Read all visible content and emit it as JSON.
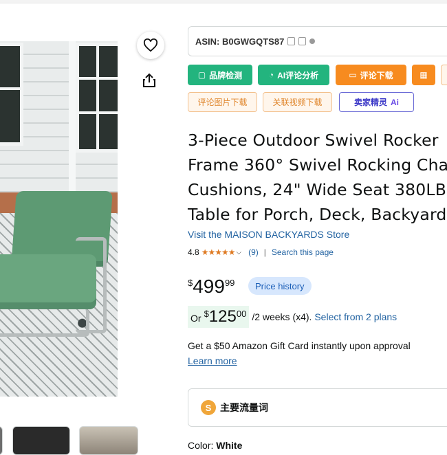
{
  "product": {
    "title_lines": [
      "3-Piece Outdoor Swivel Rocker",
      "Frame 360° Swivel Rocking Cha",
      "Cushions, 24\" Wide Seat 380LB",
      "Table for Porch, Deck, Backyard"
    ],
    "store_link": "Visit the MAISON BACKYARDS Store",
    "rating": "4.8",
    "rating_value": 4.8,
    "review_count": "(9)",
    "search_link": "Search this page",
    "price": {
      "symbol": "$",
      "whole": "499",
      "fraction": "99"
    },
    "price_history": "Price history",
    "installment": {
      "or": "Or",
      "symbol": "$",
      "whole": "125",
      "fraction": "00",
      "terms": "/2 weeks (x4).",
      "plans_link": "Select from 2 plans"
    },
    "gift_card": "Get a $50 Amazon Gift Card instantly upon approval",
    "learn_more": "Learn more",
    "color_label": "Color:",
    "color_value": "White"
  },
  "plugin": {
    "asin": "ASIN: B0GWGQTS87",
    "buttons": {
      "brand_check": "品牌检测",
      "ai_review": "AI评论分析",
      "review_download": "评论下载",
      "review_images": "评论图片下载",
      "related_videos": "关联视频下载",
      "seller_sprite": "卖家精灵",
      "seller_sprite_ai": "Ai"
    },
    "keyword_section": "主要流量词",
    "keyword_icon": "S"
  },
  "colors": {
    "green": "#23b47e",
    "orange": "#f78b1f",
    "link": "#2162a1",
    "star": "#de7921"
  }
}
